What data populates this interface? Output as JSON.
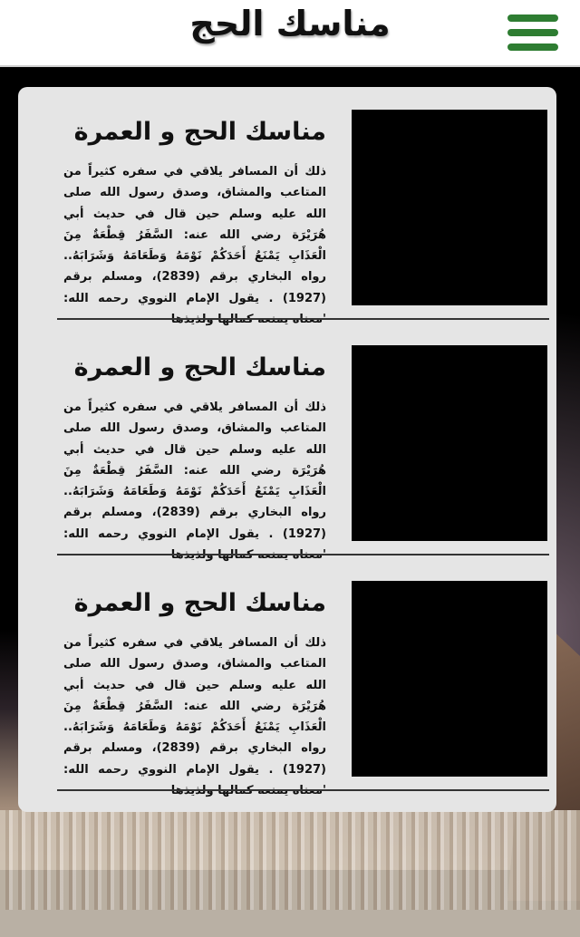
{
  "header": {
    "title": "مناسك الحج",
    "menu_icon": "hamburger-menu-icon",
    "menu_color": "#2e7d32"
  },
  "cards": [
    {
      "title": "مناسك الحج و العمرة",
      "text": "ذلك أن المسافر يلاقي في سفره كثيراً من المتاعب والمشاق، وصدق رسول الله صلى الله عليه وسلم حين قال في حديث أبي هُرَيْرَة رضي الله عنه: السَّفَرُ قِطْعَةٌ مِنَ الْعَذَابِ يَمْنَعُ أَحَدَكُمْ نَوْمَهُ وَطَعَامَهُ وَشَرَابَهُ.. رواه البخاري برقم (2839)، ومسلم برقم (1927) . يقول الإمام النووي رحمه الله: 'معناه يمنعه كمالها ولذيذها"
    },
    {
      "title": "مناسك الحج و العمرة",
      "text": "ذلك أن المسافر يلاقي في سفره كثيراً من المتاعب والمشاق، وصدق رسول الله صلى الله عليه وسلم حين قال في حديث أبي هُرَيْرَة رضي الله عنه: السَّفَرُ قِطْعَةٌ مِنَ الْعَذَابِ يَمْنَعُ أَحَدَكُمْ نَوْمَهُ وَطَعَامَهُ وَشَرَابَهُ.. رواه البخاري برقم (2839)، ومسلم برقم (1927) . يقول الإمام النووي رحمه الله: 'معناه يمنعه كمالها ولذيذها"
    },
    {
      "title": "مناسك الحج و العمرة",
      "text": "ذلك أن المسافر يلاقي في سفره كثيراً من المتاعب والمشاق، وصدق رسول الله صلى الله عليه وسلم حين قال في حديث أبي هُرَيْرَة رضي الله عنه: السَّفَرُ قِطْعَةٌ مِنَ الْعَذَابِ يَمْنَعُ أَحَدَكُمْ نَوْمَهُ وَطَعَامَهُ وَشَرَابَهُ.. رواه البخاري برقم (2839)، ومسلم برقم (1927) . يقول الإمام النووي رحمه الله: 'معناه يمنعه كمالها ولذيذها"
    }
  ]
}
